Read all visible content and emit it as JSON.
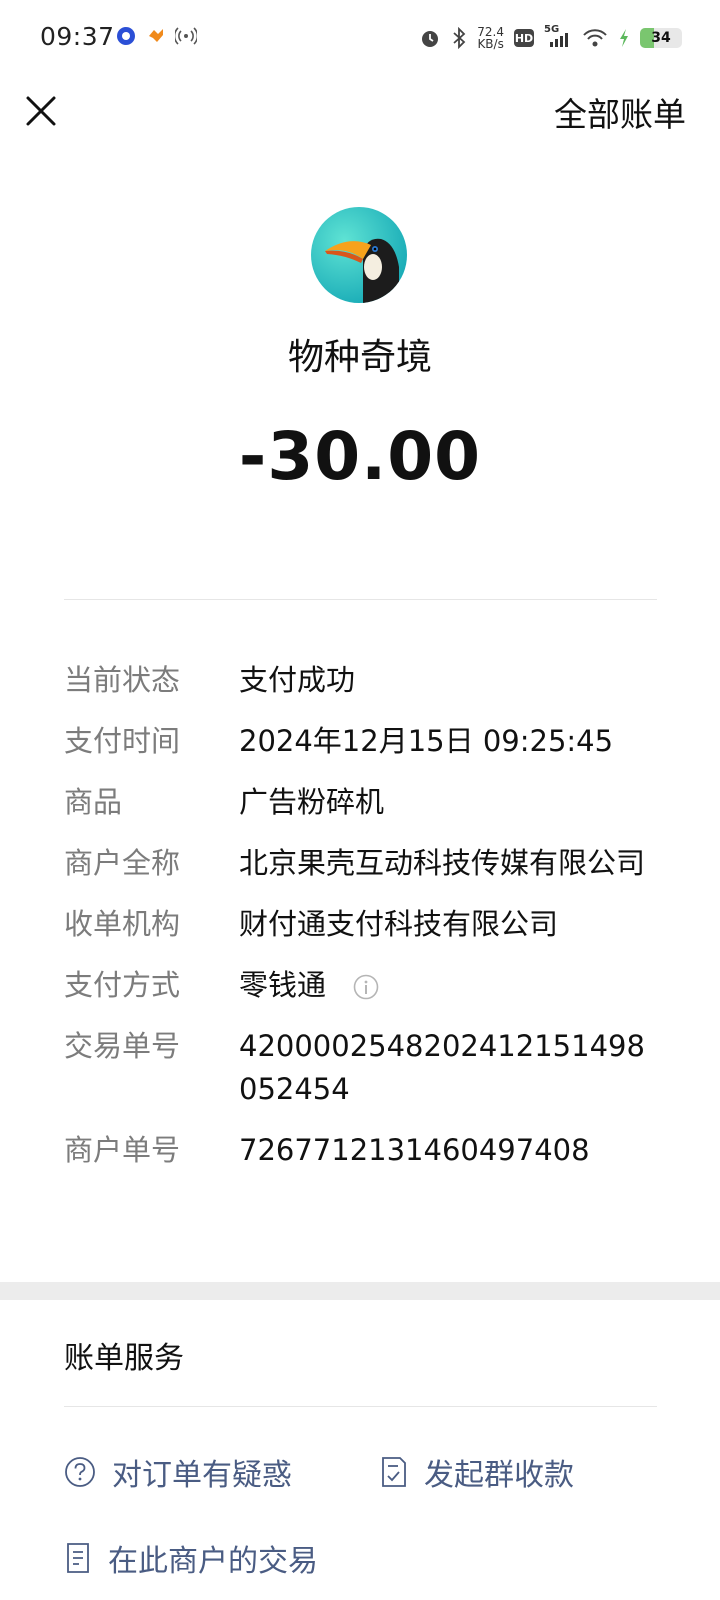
{
  "status_bar": {
    "time": "09:37",
    "net_speed_value": "72.4",
    "net_speed_unit": "KB/s",
    "hd_badge": "HD",
    "signal_label": "5G",
    "battery": "34",
    "icons": [
      "app-notification-icon",
      "app-notification-icon-2",
      "hotspot-icon",
      "alarm-icon",
      "bluetooth-icon",
      "cellular-signal-icon",
      "wifi-icon",
      "charging-icon",
      "battery-icon"
    ]
  },
  "nav": {
    "close_icon": "close-icon",
    "all_bills_label": "全部账单"
  },
  "merchant": {
    "name": "物种奇境",
    "amount": "-30.00"
  },
  "details": [
    {
      "label": "当前状态",
      "value": "支付成功"
    },
    {
      "label": "支付时间",
      "value": "2024年12月15日 09:25:45"
    },
    {
      "label": "商品",
      "value": "广告粉碎机"
    },
    {
      "label": "商户全称",
      "value": "北京果壳互动科技传媒有限公司"
    },
    {
      "label": "收单机构",
      "value": "财付通支付科技有限公司"
    },
    {
      "label": "支付方式",
      "value": "零钱通"
    },
    {
      "label": "交易单号",
      "value": "4200002548202412151498052454"
    },
    {
      "label": "商户单号",
      "value": "726771213146049740‌8"
    }
  ],
  "services": {
    "title": "账单服务",
    "items": [
      {
        "label": "对订单有疑惑",
        "icon": "question-circle-icon"
      },
      {
        "label": "发起群收款",
        "icon": "group-collect-icon"
      },
      {
        "label": "在此商户的交易",
        "icon": "document-list-icon"
      }
    ]
  },
  "colors": {
    "service_link": "#4a5c83",
    "label_gray": "#7c7c7c",
    "separator": "#ececec"
  }
}
